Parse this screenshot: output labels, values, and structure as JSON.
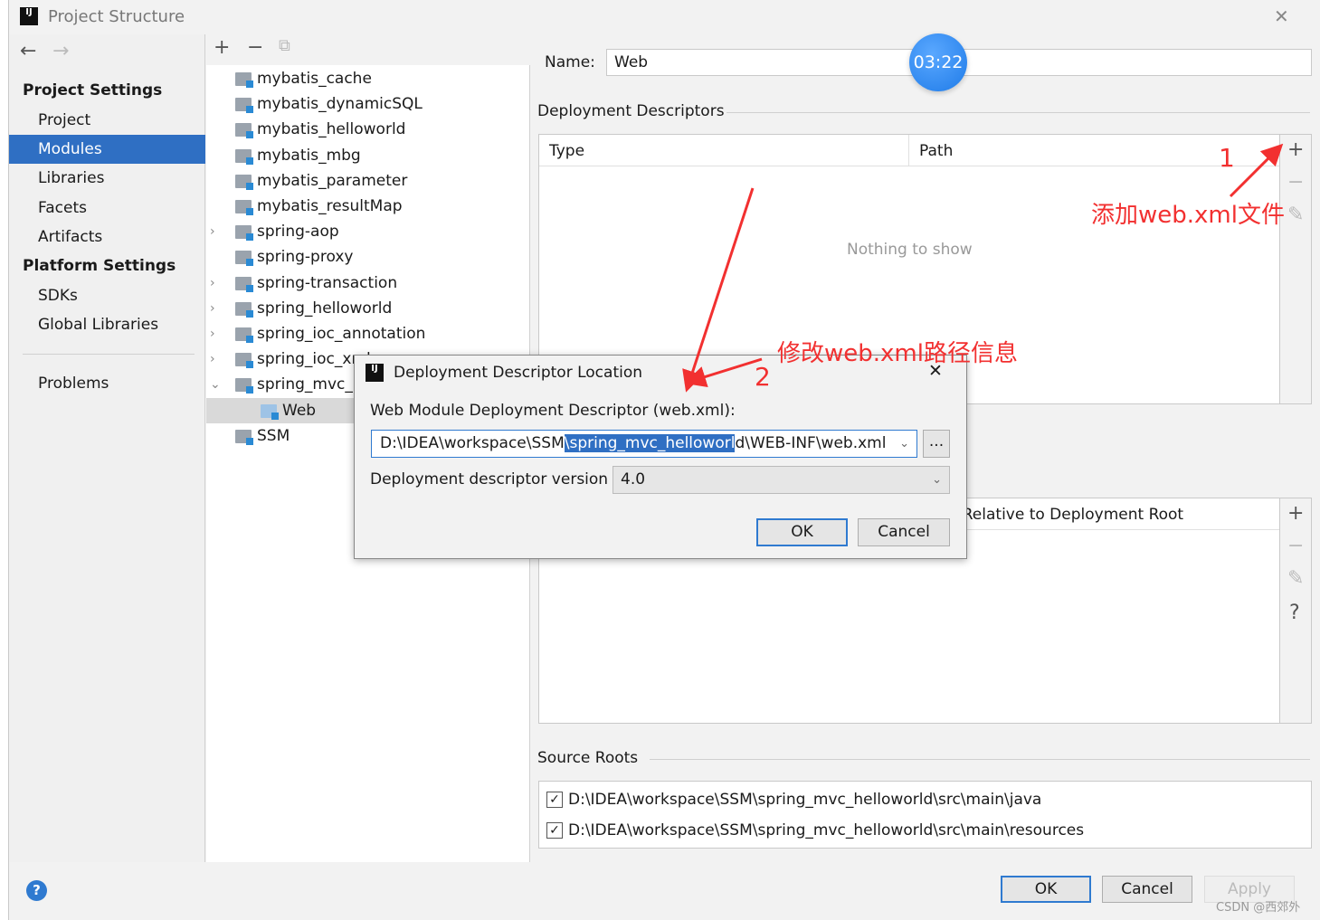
{
  "window": {
    "title": "Project Structure",
    "close": "✕"
  },
  "nav": {
    "back": "←",
    "forward": "→"
  },
  "sidebar": {
    "project_settings": "Project Settings",
    "items": [
      {
        "label": "Project"
      },
      {
        "label": "Modules",
        "selected": true
      },
      {
        "label": "Libraries"
      },
      {
        "label": "Facets"
      },
      {
        "label": "Artifacts"
      }
    ],
    "platform_settings": "Platform Settings",
    "platform_items": [
      {
        "label": "SDKs"
      },
      {
        "label": "Global Libraries"
      }
    ],
    "problems": "Problems"
  },
  "tree": {
    "toolbar": {
      "add": "+",
      "remove": "−",
      "copy": "⧉"
    },
    "items": [
      {
        "label": "mybatis_cache"
      },
      {
        "label": "mybatis_dynamicSQL"
      },
      {
        "label": "mybatis_helloworld"
      },
      {
        "label": "mybatis_mbg"
      },
      {
        "label": "mybatis_parameter"
      },
      {
        "label": "mybatis_resultMap"
      },
      {
        "label": "spring-aop",
        "chevron": "›"
      },
      {
        "label": "spring-proxy"
      },
      {
        "label": "spring-transaction",
        "chevron": "›"
      },
      {
        "label": "spring_helloworld",
        "chevron": "›"
      },
      {
        "label": "spring_ioc_annotation",
        "chevron": "›"
      },
      {
        "label": "spring_ioc_xml",
        "chevron": "›"
      },
      {
        "label": "spring_mvc_helloworld",
        "chevron": "⌄"
      },
      {
        "label": "Web",
        "selected": true,
        "child": true
      },
      {
        "label": "SSM"
      }
    ]
  },
  "details": {
    "name_label": "Name:",
    "name_value": "Web",
    "deployment_descriptors": "Deployment Descriptors",
    "dd_columns": [
      "Type",
      "Path"
    ],
    "dd_empty": "Nothing to show",
    "web_resource_header": "Path Relative to Deployment Root",
    "side_toolbar": {
      "add": "+",
      "remove": "−",
      "edit": "✎",
      "help": "?"
    },
    "source_roots": "Source Roots",
    "source_root_items": [
      {
        "path": "D:\\IDEA\\workspace\\SSM\\spring_mvc_helloworld\\src\\main\\java",
        "checked": true
      },
      {
        "path": "D:\\IDEA\\workspace\\SSM\\spring_mvc_helloworld\\src\\main\\resources",
        "checked": true
      }
    ]
  },
  "footer": {
    "help": "?",
    "ok": "OK",
    "cancel": "Cancel",
    "apply": "Apply"
  },
  "dialog": {
    "title": "Deployment Descriptor Location",
    "close": "✕",
    "descriptor_label": "Web Module Deployment Descriptor (web.xml):",
    "path_before": "D:\\IDEA\\workspace\\SSM",
    "path_selected": "\\spring_mvc_helloworl",
    "path_after": "d\\WEB-INF\\web.xml",
    "browse": "...",
    "version_label": "Deployment descriptor version",
    "version_value": "4.0",
    "ok": "OK",
    "cancel": "Cancel"
  },
  "annotations": {
    "step1": "1",
    "step1_text": "添加web.xml文件",
    "step2": "2",
    "step2_text": "修改web.xml路径信息",
    "color": "#f23030"
  },
  "overlay": {
    "timer": "03:22",
    "watermark": "CSDN @西郊外"
  },
  "colors": {
    "selection": "#2f6fc3",
    "default_button_border": "#2f7ad0"
  }
}
